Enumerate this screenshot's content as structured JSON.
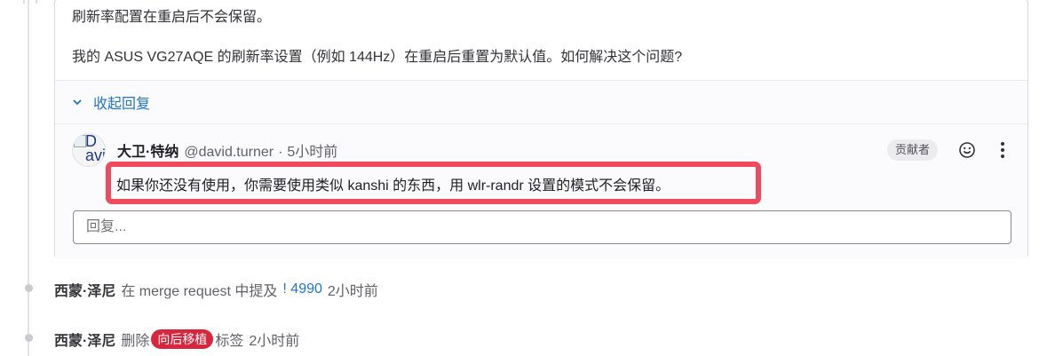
{
  "note": {
    "line1": "刷新率配置在重启后不会保留。",
    "line2": "我的 ASUS VG27AQE 的刷新率设置（例如 144Hz）在重启后重置为默认值。如何解决这个问题?"
  },
  "thread": {
    "collapse_label": "收起回复",
    "reply": {
      "avatar_alt": "D avi",
      "author_name": "大卫·特纳",
      "author_handle": "@david.turner",
      "separator": "·",
      "time": "5小时前",
      "role_badge": "贡献者",
      "text": "如果你还没有使用，你需要使用类似 kanshi 的东西，用 wlr-randr 设置的模式不会保留。"
    },
    "reply_input_placeholder": "回复..."
  },
  "system_notes": [
    {
      "actor": "西蒙·泽尼",
      "prefix": "在 merge request 中提及",
      "link": "! 4990",
      "time": "2小时前"
    },
    {
      "actor": "西蒙·泽尼",
      "prefix": "删除",
      "label": "向后移植",
      "suffix": "标签",
      "time": "2小时前"
    }
  ],
  "colors": {
    "link": "#1f75cb",
    "highlight_border": "#ef4a5e",
    "label_bg": "#d7263d"
  }
}
